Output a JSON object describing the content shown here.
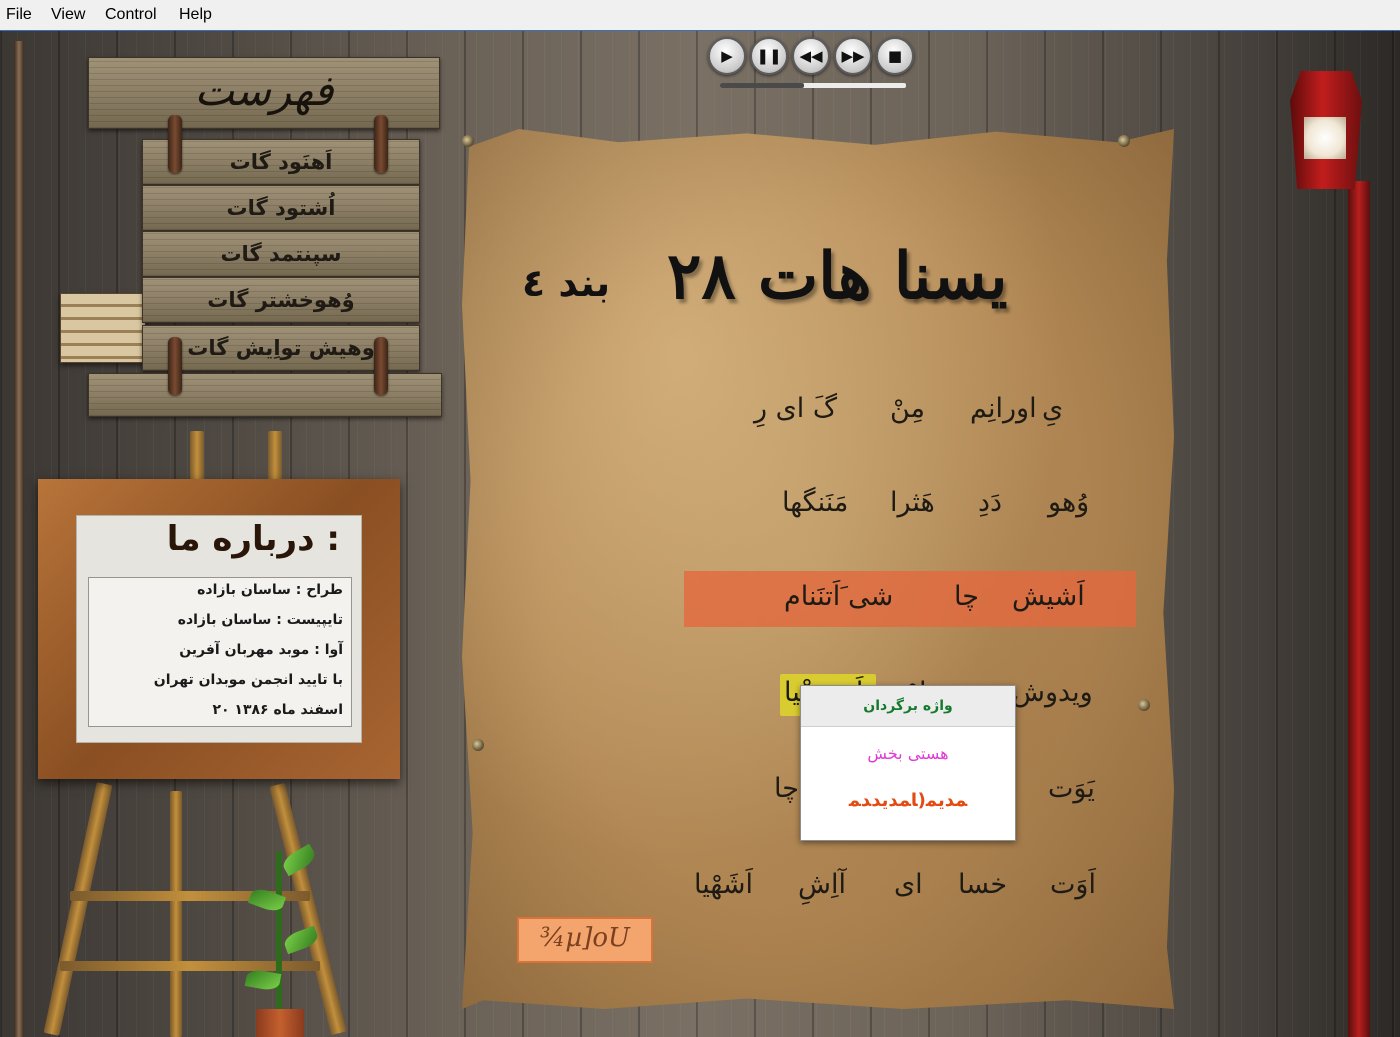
{
  "menubar": {
    "items": [
      "File",
      "View",
      "Control",
      "Help"
    ]
  },
  "media": {
    "play_icon": "▶",
    "pause_icon": "❚❚",
    "rewind_icon": "◀◀",
    "forward_icon": "▶▶",
    "stop_icon": "■",
    "progress": 0.45
  },
  "index": {
    "title": "فهرست",
    "items": [
      "اَهنَود گات",
      "اُشتود گات",
      "سپنتمد گات",
      "وُهوخشتر گات",
      "وهیش تواِیش گات"
    ]
  },
  "about": {
    "title": "درباره ما :",
    "lines": [
      "طراح : ساسان بازاده",
      "تایپیست : ساسان بازاده",
      "آوا : موبد مهربان آفرین",
      "با تایید انجمن موبدان تهران",
      "۲۰ اسفند ماه ۱۳۸۶"
    ]
  },
  "page": {
    "chapter_title": "یسنا هات ۲۸",
    "verse_ref": "بند ٤"
  },
  "verse": {
    "line1": [
      "یِ",
      "اورانِم",
      "مِنْ",
      "گَ ای رِ"
    ],
    "line2": [
      "وُهو",
      "دَدِ",
      "هَثرا",
      "مَنَنگها"
    ],
    "line3": [
      "اَشیش",
      "چا",
      "شی َاَتنَنام"
    ],
    "line4": [
      "ویدوش",
      "مَزداوْ",
      "اَهورَهْیا"
    ],
    "line5": [
      "یَوَت",
      "چا"
    ],
    "line6": [
      "اَوَت",
      "خسا",
      "ای",
      "آاِشِ",
      "اَشَهْیا"
    ]
  },
  "tooltip": {
    "header": "واژه برگردان",
    "meaning": "هستی بخش",
    "avestan": "ﻤﺪﯾﻤ(ﺎﻤﺪﯾﺪﺪﻤ"
  },
  "odd_box": {
    "text": "¾µ]oU"
  },
  "colors": {
    "line_highlight": "#e4683e",
    "word_highlight": "#ded628",
    "tooltip_header_text": "#157a2c",
    "tooltip_meaning": "#e03bd4",
    "tooltip_avestan": "#e24b12"
  }
}
